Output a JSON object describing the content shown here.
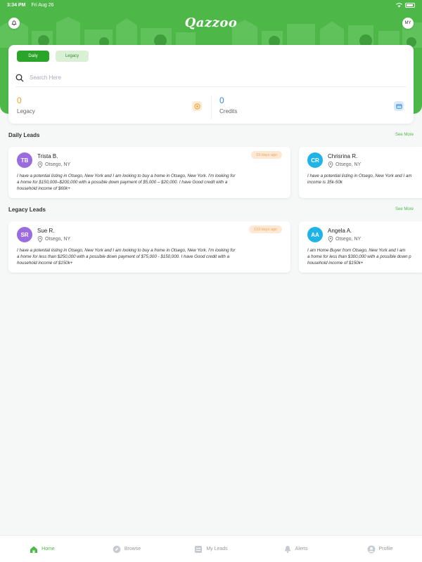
{
  "status": {
    "time": "3:34 PM",
    "date": "Fri Aug 26"
  },
  "header": {
    "logo": "Qazzoo",
    "profile_initials": "MY"
  },
  "toggle": {
    "daily_label": "Daily",
    "legacy_label": "Legacy",
    "selected": "Daily"
  },
  "search": {
    "placeholder": "Search Here"
  },
  "stats": {
    "legacy": {
      "value": "0",
      "label": "Legacy",
      "color": "#f0a030"
    },
    "credits": {
      "value": "0",
      "label": "Credits",
      "color": "#2f8de0"
    }
  },
  "daily_leads": {
    "title": "Daily Leads",
    "see_more": "See More",
    "items": [
      {
        "initials": "TB",
        "name": "Trista B.",
        "location": "Otsego, NY",
        "age": "19 days ago",
        "avatar_color": "#9b6be0",
        "desc1": "I have a potential listing in Otsego, New York and I am looking to buy a home in Otsego, New York. I'm looking for",
        "desc2": "a home for $150,000–$200,000 with a possible down payment of $5,000 – $20,000. I have Good credit with a",
        "desc3": "household income of $60k+"
      },
      {
        "initials": "CR",
        "name": "Chrisrina R.",
        "location": "Otsego, NY",
        "avatar_color": "#1fb4e8",
        "desc1": "I have a potential listing in Otsego, New York and I am",
        "desc2": "income is 35k-50k"
      }
    ]
  },
  "legacy_leads": {
    "title": "Legacy Leads",
    "see_more": "See More",
    "items": [
      {
        "initials": "SR",
        "name": "Sue R.",
        "location": "Otsego, NY",
        "age": "133 days ago",
        "avatar_color": "#9b6be0",
        "desc1": "I have a potential listing in Otsego, New York and I am looking to buy a home in Otsego, New York. I'm looking for",
        "desc2": "a home for less than  $250,000 with a possible down payment of $75,000 - $150,000. I have Good credit with a",
        "desc3": "household income of $150k+"
      },
      {
        "initials": "AA",
        "name": "Angela A.",
        "location": "Otsego, NY",
        "avatar_color": "#1fb4e8",
        "desc1": "I am  Home Buyer from Otsego, New York and I am",
        "desc2": "a home for less than $300,000 with a possible down p",
        "desc3": "household income of $150k+"
      }
    ]
  },
  "tabs": [
    {
      "label": "Home",
      "icon": "home-icon"
    },
    {
      "label": "Browse",
      "icon": "compass-icon"
    },
    {
      "label": "My Leads",
      "icon": "list-icon"
    },
    {
      "label": "Alerts",
      "icon": "bell-icon"
    },
    {
      "label": "Profile",
      "icon": "user-icon"
    }
  ],
  "colors": {
    "brand_green": "#4db848",
    "accent_orange": "#f0a030",
    "accent_blue": "#2f8de0"
  }
}
